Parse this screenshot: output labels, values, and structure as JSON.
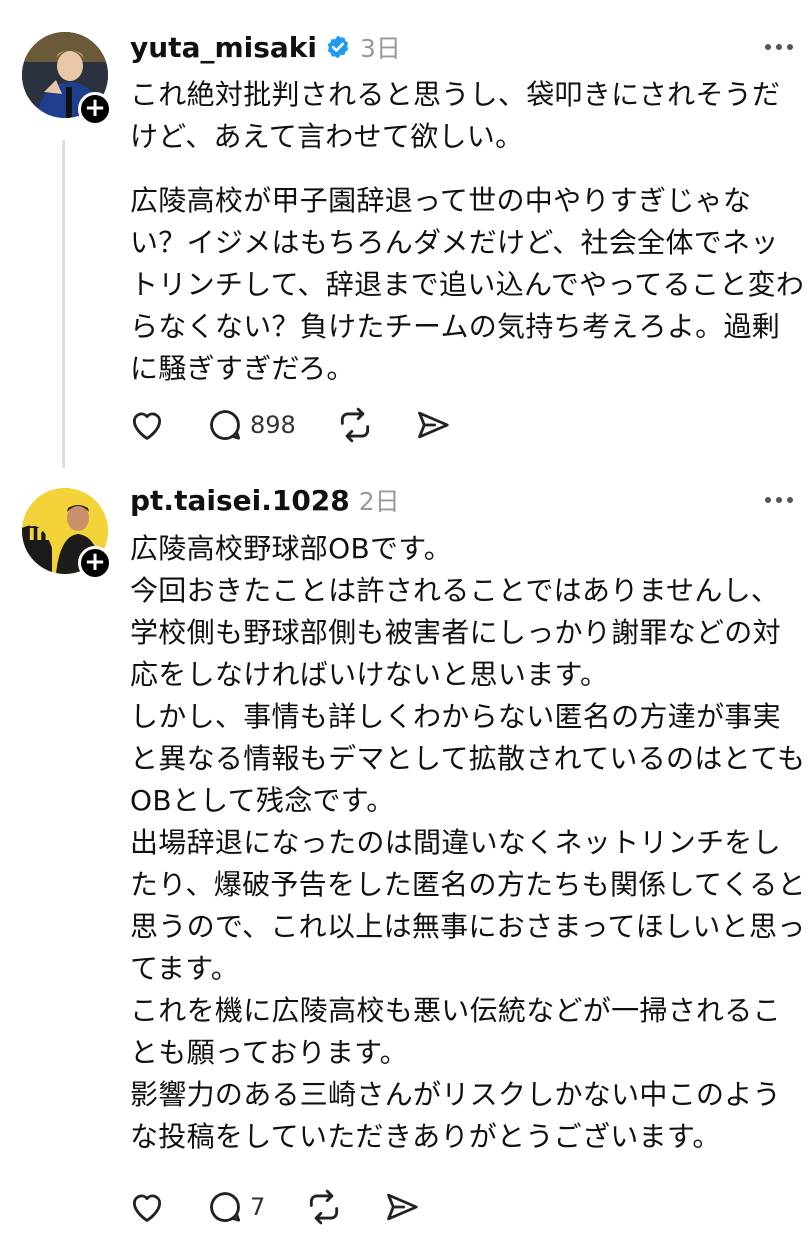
{
  "posts": [
    {
      "username": "yuta_misaki",
      "verified": true,
      "time": "3日",
      "paragraphs": [
        "これ絶対批判されると思うし、袋叩きにされそうだけど、あえて言わせて欲しい。",
        "広陵高校が甲子園辞退って世の中やりすぎじゃない？イジメはもちろんダメだけど、社会全体でネットリンチして、辞退まで追い込んでやってること変わらなくない？負けたチームの気持ち考えろよ。過剰に騒ぎすぎだろ。"
      ],
      "reply_count": "898",
      "icons": [
        "heart-icon",
        "comment-icon",
        "repost-icon",
        "share-icon"
      ]
    },
    {
      "username": "pt.taisei.1028",
      "verified": false,
      "time": "2日",
      "paragraphs": [
        "広陵高校野球部OBです。",
        "今回おきたことは許されることではありませんし、学校側も野球部側も被害者にしっかり謝罪などの対応をしなければいけないと思います。",
        "しかし、事情も詳しくわからない匿名の方達が事実と異なる情報もデマとして拡散されているのはとてもOBとして残念です。",
        "出場辞退になったのは間違いなくネットリンチをしたり、爆破予告をした匿名の方たちも関係してくると思うので、これ以上は無事におさまってほしいと思ってます。",
        "これを機に広陵高校も悪い伝統などが一掃されることも願っております。",
        "影響力のある三崎さんがリスクしかない中このような投稿をしていただきありがとうございます。"
      ],
      "reply_count": "7",
      "icons": [
        "heart-icon",
        "comment-icon",
        "repost-icon",
        "share-icon"
      ]
    }
  ],
  "follow_badge_symbol": "+",
  "colors": {
    "verified": "#1D9BF0",
    "meta": "#999999",
    "text": "#111111"
  }
}
